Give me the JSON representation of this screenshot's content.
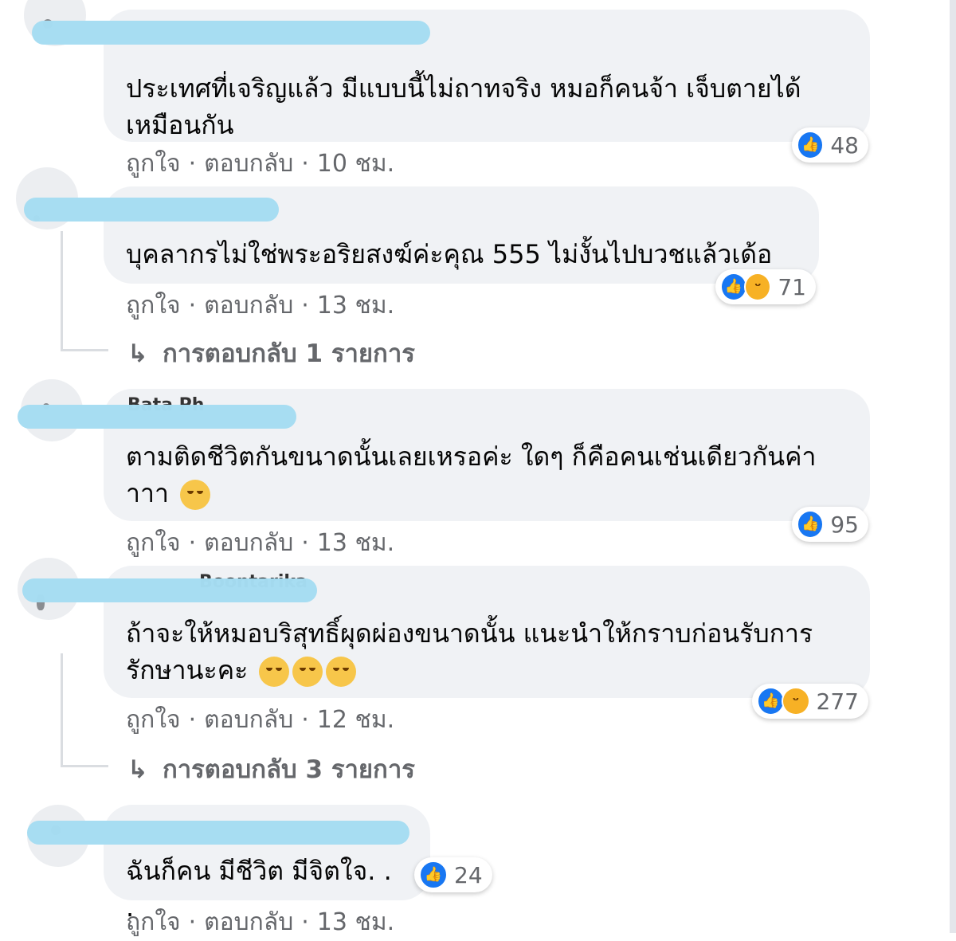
{
  "comments": [
    {
      "author": "",
      "text": "ประเทศที่เจริญแล้ว มีแบบนี้ไม่ถาทจริง หมอก็คนจ้า เจ็บตายได้เหมือนกัน",
      "emojis": [],
      "like_label": "ถูกใจ",
      "reply_label": "ตอบกลับ",
      "time": "10 ชม.",
      "reaction_icons": [
        "like-icon"
      ],
      "reaction_count": "48",
      "replies_label": ""
    },
    {
      "author": "",
      "text": "บุคลากรไม่ใช่พระอริยสงฆ์ค่ะคุณ 555 ไม่งั้นไปบวชแล้วเด้อ",
      "emojis": [],
      "like_label": "ถูกใจ",
      "reply_label": "ตอบกลับ",
      "time": "13 ชม.",
      "reaction_icons": [
        "like-icon",
        "haha-icon"
      ],
      "reaction_count": "71",
      "replies_label": "การตอบกลับ 1 รายการ"
    },
    {
      "author": "Bata Ph",
      "text": "ตามติดชีวิตกันขนาดนั้นเลยเหรอค่ะ ใดๆ ก็คือคนเช่นเดียวกันค่าาาา",
      "emojis": [
        "rolling-eyes-emoji"
      ],
      "like_label": "ถูกใจ",
      "reply_label": "ตอบกลับ",
      "time": "13 ชม.",
      "reaction_icons": [
        "like-icon"
      ],
      "reaction_count": "95",
      "replies_label": ""
    },
    {
      "author": "Boontarika",
      "text": "ถ้าจะให้หมอบริสุทธิ์ผุดผ่องขนาดนั้น แนะนำให้กราบก่อนรับการรักษานะคะ",
      "emojis": [
        "relieved-emoji",
        "relieved-emoji",
        "relieved-emoji"
      ],
      "like_label": "ถูกใจ",
      "reply_label": "ตอบกลับ",
      "time": "12 ชม.",
      "reaction_icons": [
        "like-icon",
        "haha-icon"
      ],
      "reaction_count": "277",
      "replies_label": "การตอบกลับ 3 รายการ"
    },
    {
      "author": "",
      "text": "ฉันก็คน มีชีวิต มีจิตใจ. . .",
      "emojis": [],
      "like_label": "ถูกใจ",
      "reply_label": "ตอบกลับ",
      "time": "13 ชม.",
      "reaction_icons": [
        "like-icon"
      ],
      "reaction_count": "24",
      "replies_label": ""
    }
  ],
  "separator": "·",
  "reply_arrow": "↳",
  "colors": {
    "bubble": "#f0f2f5",
    "secondary_text": "#65676b",
    "like_blue": "#1877f2",
    "haha_yellow": "#f7b125",
    "scribble": "#a5dcf2"
  }
}
